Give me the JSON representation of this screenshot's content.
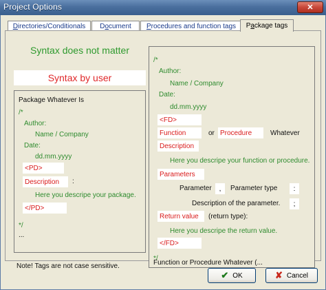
{
  "window": {
    "title": "Project Options",
    "close_glyph": "✕",
    "close_icon": "close-icon"
  },
  "tabs": [
    {
      "label": "Directories/Conditionals",
      "underline_char": "D"
    },
    {
      "label": "Document",
      "underline_char": "o"
    },
    {
      "label": "Procedures and function tags",
      "underline_char": "P"
    },
    {
      "label": "Package tags",
      "underline_char": "a",
      "active": true
    }
  ],
  "left": {
    "syntax_title": "Syntax does not matter",
    "syntax_user": "Syntax by user",
    "package_line": "Package Whatever Is",
    "open_comment": "/*",
    "author_label": "Author:",
    "author_value": "Name / Company",
    "date_label": "Date:",
    "date_value": "dd.mm.yyyy",
    "pd_tag": "<PD>",
    "description_tag": "Description",
    "colon": ":",
    "package_description": "Here you descripe your package.",
    "pd_close_tag": "</PD>",
    "close_comment": "*/",
    "ellipsis": "..."
  },
  "right": {
    "open_comment": "/*",
    "author_label": "Author:",
    "author_value": "Name / Company",
    "date_label": "Date:",
    "date_value": "dd.mm.yyyy",
    "fd_tag": "<FD>",
    "function_tag": "Function",
    "or_text": "or",
    "procedure_tag": "Procedure",
    "whatever_text": "Whatever",
    "description_tag": "Description",
    "function_description": "Here you descripe your function or procedure.",
    "parameters_tag": "Parameters",
    "parameter_text": "Parameter",
    "comma": ",",
    "parameter_type_text": "Parameter type",
    "colon": ":",
    "param_description": "Description of the parameter.",
    "semicolon": ";",
    "return_value_tag": "Return value",
    "return_type_text": "(return type):",
    "return_description": "Here you descripe the return value.",
    "fd_close_tag": "</FD>",
    "close_comment": "*/",
    "function_line": "Function or Procedure Whatever (..."
  },
  "note": "Note! Tags are not case sensitive.",
  "buttons": {
    "ok_label": "OK",
    "ok_icon": "checkmark-icon",
    "ok_glyph": "✔",
    "cancel_label": "Cancel",
    "cancel_icon": "x-icon",
    "cancel_glyph": "✘"
  }
}
